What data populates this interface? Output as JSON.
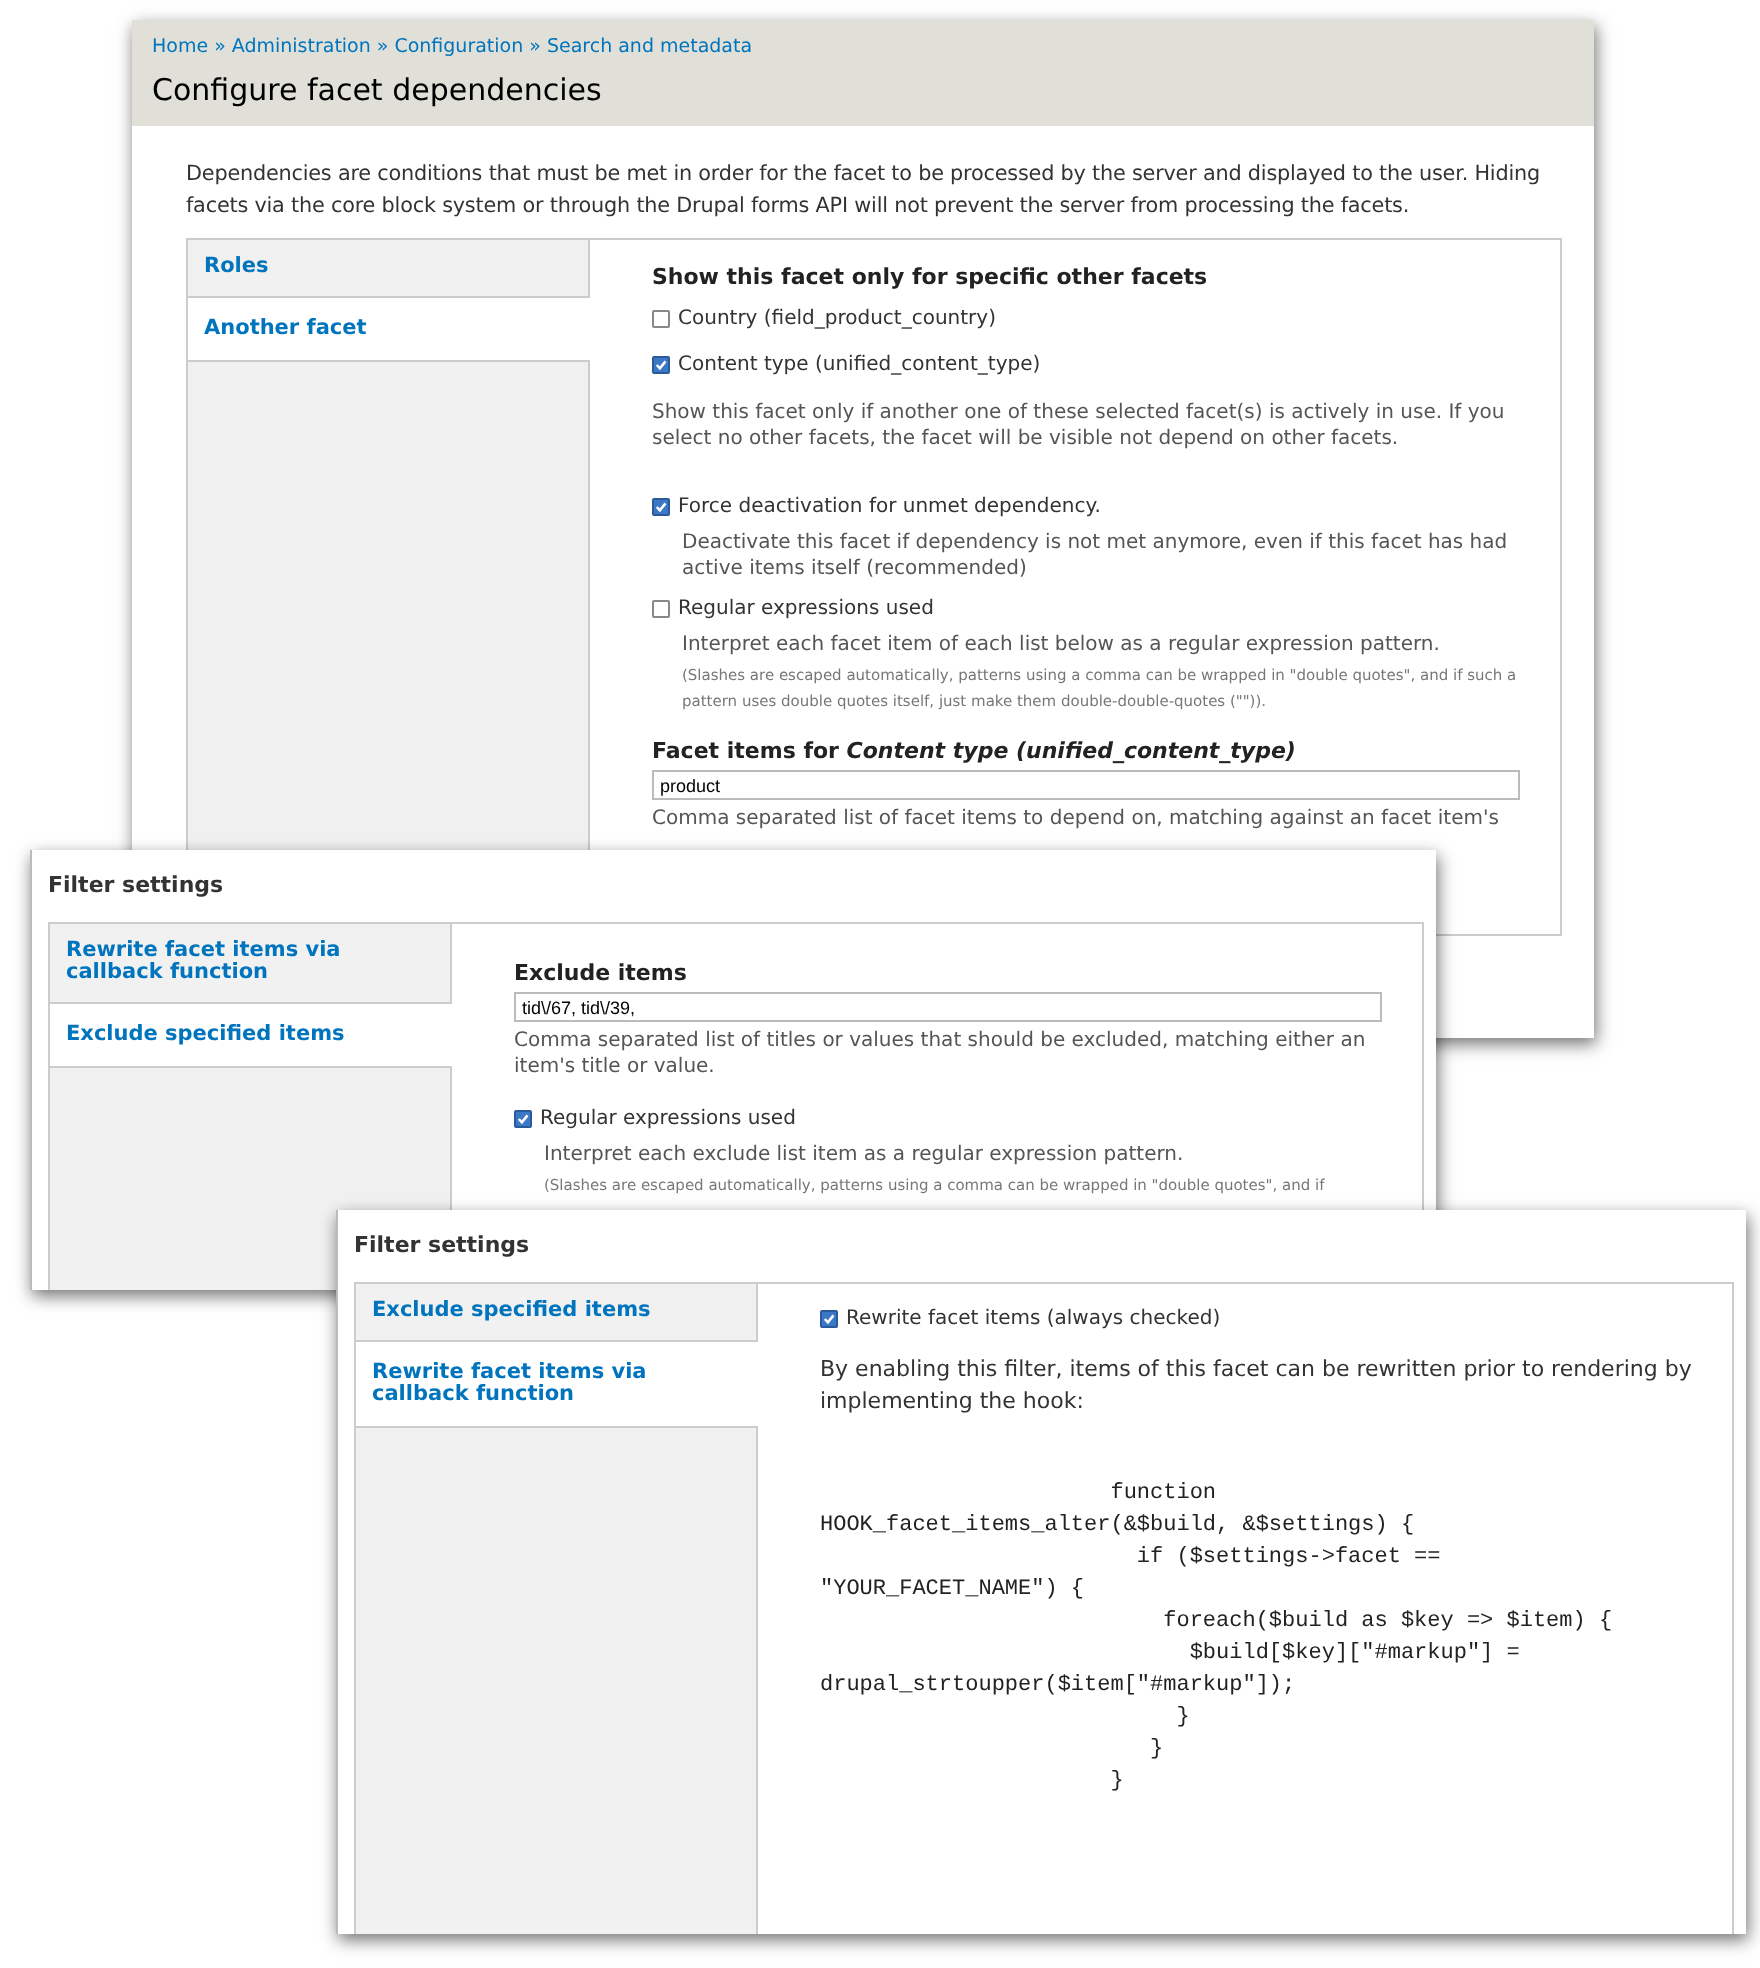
{
  "windows": [
    {
      "kind": "page",
      "breadcrumb": [
        "Home",
        "Administration",
        "Configuration",
        "Search and metadata"
      ],
      "breadcrumb_separator": "»",
      "title": "Configure facet dependencies",
      "description": "Dependencies are conditions that must be met in order for the facet to be processed by the server and displayed to the user. Hiding facets via the core block system or through the Drupal forms API will not prevent the server from processing the facets.",
      "tabs": [
        {
          "label": "Roles",
          "selected": false
        },
        {
          "label": "Another facet",
          "selected": true
        }
      ],
      "content": [
        {
          "kind": "heading",
          "text": "Show this facet only for specific other facets"
        },
        {
          "kind": "checkbox",
          "label": "Country (field_product_country)",
          "checked": false
        },
        {
          "kind": "checkbox",
          "label": "Content type (unified_content_type)",
          "checked": true
        },
        {
          "kind": "text",
          "text": "Show this facet only if another one of these selected facet(s) is actively in use. If you select no other facets, the facet will be visible not depend on other facets."
        },
        {
          "kind": "checkbox",
          "label": "Force deactivation for unmet dependency.",
          "checked": true,
          "description": "Deactivate this facet if dependency is not met anymore, even if this facet has had active items itself (recommended)"
        },
        {
          "kind": "checkbox",
          "label": "Regular expressions used",
          "checked": false,
          "description": "Interpret each facet item of each list below as a regular expression pattern.",
          "note": "(Slashes are escaped automatically, patterns using a comma can be wrapped in \"double quotes\", and if such a pattern uses double quotes itself, just make them double-double-quotes (\"\"))."
        },
        {
          "kind": "field",
          "label": "Facet items for *Content type (unified_content_type)*",
          "value": "product",
          "description": "Comma separated list of facet items to depend on, matching against an facet item's"
        }
      ]
    },
    {
      "kind": "dialog",
      "title": "Filter settings",
      "tabs": [
        {
          "label": "Rewrite facet items via callback function",
          "selected": false
        },
        {
          "label": "Exclude specified items",
          "selected": true
        }
      ],
      "content": [
        {
          "kind": "field",
          "label": "Exclude items",
          "value": "tid\\/67, tid\\/39,",
          "description": "Comma separated list of titles or values that should be excluded, matching either an item's title or value."
        },
        {
          "kind": "checkbox",
          "label": "Regular expressions used",
          "checked": true,
          "description": "Interpret each exclude list item as a regular expression pattern.",
          "note": "(Slashes are escaped automatically, patterns using a comma can be wrapped in \"double quotes\", and if"
        }
      ]
    },
    {
      "kind": "dialog",
      "title": "Filter settings",
      "tabs": [
        {
          "label": "Exclude specified items",
          "selected": false
        },
        {
          "label": "Rewrite facet items via callback function",
          "selected": true
        }
      ],
      "content": [
        {
          "kind": "checkbox",
          "label": "Rewrite facet items (always checked)",
          "checked": true
        },
        {
          "kind": "text",
          "text": "By enabling this filter, items of this facet can be rewritten prior to rendering by implementing the hook:"
        },
        {
          "kind": "code",
          "lines": [
            "                      function",
            "HOOK_facet_items_alter(&$build, &$settings) {",
            "                        if ($settings->facet ==",
            "\"YOUR_FACET_NAME\") {",
            "                          foreach($build as $key => $item) {",
            "                            $build[$key][\"#markup\"] =",
            "drupal_strtoupper($item[\"#markup\"]);",
            "                           }",
            "                         }",
            "                      }"
          ]
        }
      ]
    }
  ]
}
